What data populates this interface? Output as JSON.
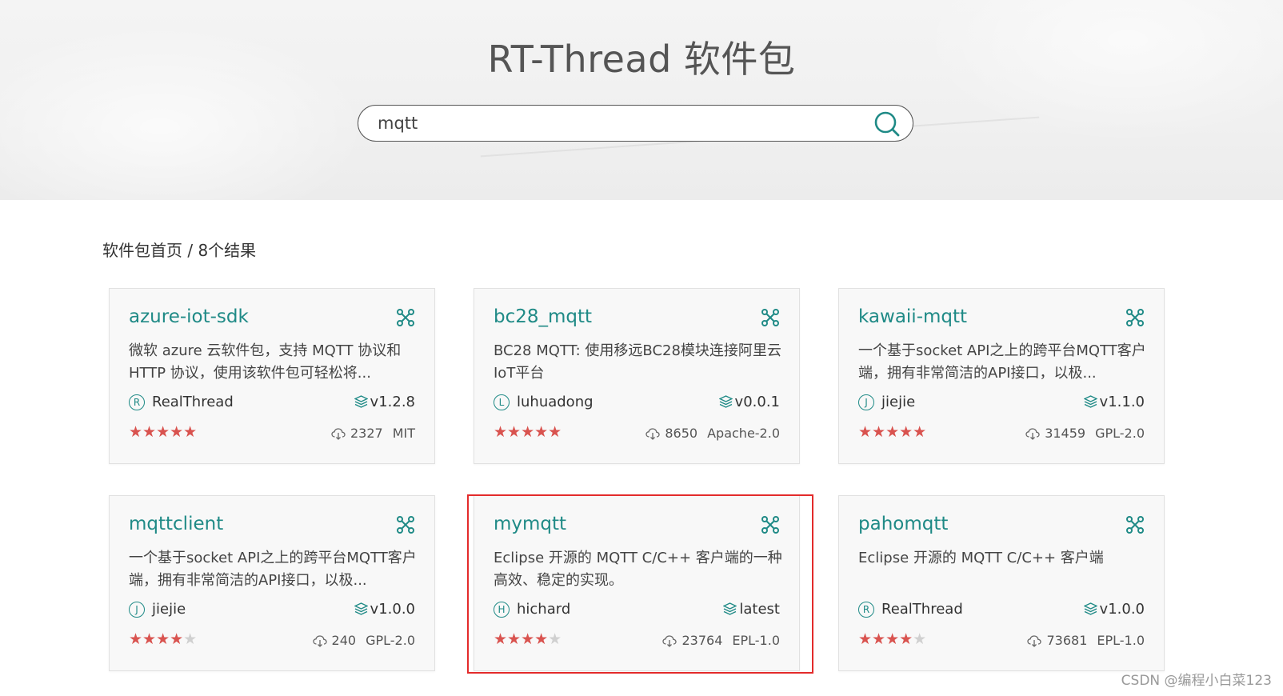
{
  "header": {
    "title": "RT-Thread 软件包"
  },
  "search": {
    "value": "mqtt"
  },
  "breadcrumb": {
    "home": "软件包首页",
    "separator": " / ",
    "results": "8个结果"
  },
  "packages": [
    {
      "name": "azure-iot-sdk",
      "description": "微软 azure 云软件包，支持 MQTT 协议和 HTTP 协议，使用该软件包可轻松将...",
      "author_initial": "R",
      "author": "RealThread",
      "version": "v1.2.8",
      "rating": 5,
      "stars_on": "★★★★★",
      "stars_off": "",
      "downloads": "2327",
      "license": "MIT"
    },
    {
      "name": "bc28_mqtt",
      "description": "BC28 MQTT: 使用移远BC28模块连接阿里云IoT平台",
      "author_initial": "L",
      "author": "luhuadong",
      "version": "v0.0.1",
      "rating": 5,
      "stars_on": "★★★★★",
      "stars_off": "",
      "downloads": "8650",
      "license": "Apache-2.0"
    },
    {
      "name": "kawaii-mqtt",
      "description": "一个基于socket API之上的跨平台MQTT客户端，拥有非常简洁的API接口，以极...",
      "author_initial": "J",
      "author": "jiejie",
      "version": "v1.1.0",
      "rating": 5,
      "stars_on": "★★★★★",
      "stars_off": "",
      "downloads": "31459",
      "license": "GPL-2.0"
    },
    {
      "name": "mqttclient",
      "description": "一个基于socket API之上的跨平台MQTT客户端，拥有非常简洁的API接口，以极...",
      "author_initial": "J",
      "author": "jiejie",
      "version": "v1.0.0",
      "rating": 4,
      "stars_on": "★★★★",
      "stars_off": "★",
      "downloads": "240",
      "license": "GPL-2.0"
    },
    {
      "name": "mymqtt",
      "description": "Eclipse 开源的 MQTT C/C++ 客户端的一种高效、稳定的实现。",
      "author_initial": "H",
      "author": "hichard",
      "version": "latest",
      "rating": 4,
      "stars_on": "★★★★",
      "stars_off": "★",
      "downloads": "23764",
      "license": "EPL-1.0"
    },
    {
      "name": "pahomqtt",
      "description": "Eclipse 开源的 MQTT C/C++ 客户端",
      "author_initial": "R",
      "author": "RealThread",
      "version": "v1.0.0",
      "rating": 4,
      "stars_on": "★★★★",
      "stars_off": "★",
      "downloads": "73681",
      "license": "EPL-1.0"
    }
  ],
  "colors": {
    "accent": "#1f8a86",
    "star": "#d9534f",
    "highlight_border": "#e32b2b"
  },
  "icons": {
    "search": "search-icon",
    "link": "link-icon",
    "version": "layers-icon",
    "download": "download-cloud-icon"
  },
  "watermark": "CSDN @编程小白菜123"
}
